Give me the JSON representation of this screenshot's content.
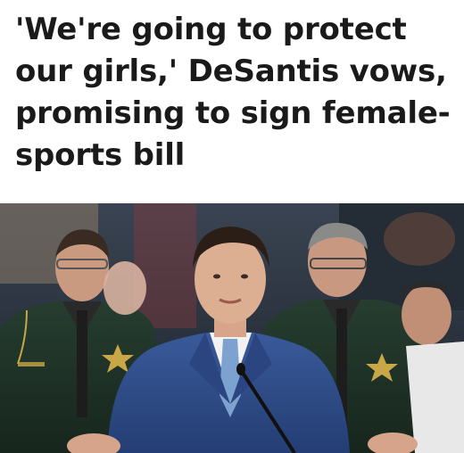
{
  "article": {
    "headline": "'We're going to protect our girls,' DeSantis vows, promising to sign female-sports bill"
  },
  "photo": {
    "subject": "press-conference-photo"
  },
  "colors": {
    "headline_text": "#1a1a1a",
    "background": "#ffffff",
    "suit_blue": "#2e4a86",
    "uniform_dark": "#1f3328",
    "badge_gold": "#c9a646"
  }
}
